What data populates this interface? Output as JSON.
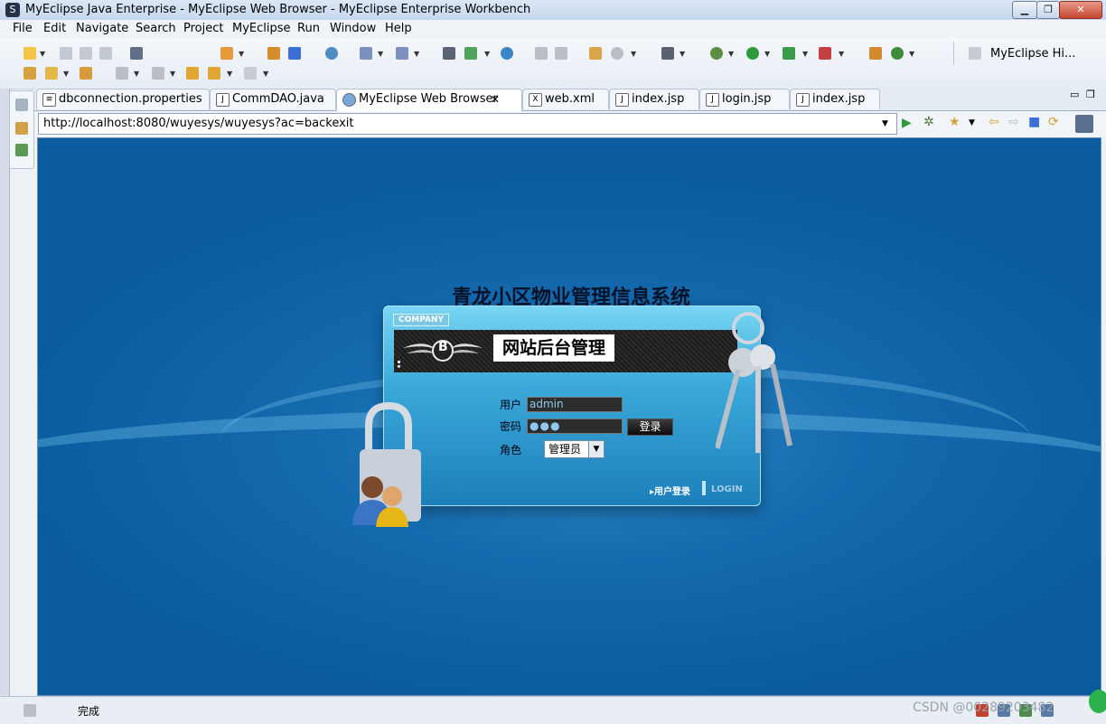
{
  "window": {
    "title": "MyEclipse Java Enterprise - MyEclipse Web Browser - MyEclipse Enterprise Workbench"
  },
  "menu": [
    "File",
    "Edit",
    "Navigate",
    "Search",
    "Project",
    "MyEclipse",
    "Run",
    "Window",
    "Help"
  ],
  "perspective": {
    "label": "MyEclipse Hi..."
  },
  "tabs": [
    {
      "label": "dbconnection.properties",
      "icon": "properties-file-icon"
    },
    {
      "label": "CommDAO.java",
      "icon": "java-file-icon"
    },
    {
      "label": "MyEclipse Web Browser",
      "icon": "web-browser-icon",
      "close": "✕"
    },
    {
      "label": "web.xml",
      "icon": "xml-file-icon"
    },
    {
      "label": "index.jsp",
      "icon": "jsp-file-icon"
    },
    {
      "label": "login.jsp",
      "icon": "jsp-file-icon"
    },
    {
      "label": "index.jsp",
      "icon": "jsp-file-icon"
    }
  ],
  "browser": {
    "url": "http://localhost:8080/wuyesys/wuyesys?ac=backexit"
  },
  "page": {
    "system_title": "青龙小区物业管理信息系统",
    "company_badge": "COMPANY",
    "banner_title": "网站后台管理",
    "logo_letter": "B",
    "username_label": "用户",
    "username_value": "admin",
    "password_label": "密码",
    "password_value": "●●●",
    "login_button": "登录",
    "role_label": "角色",
    "role_selected": "管理员",
    "footer_link": "▸用户登录",
    "footer_login": "LOGIN"
  },
  "status": {
    "text": "完成"
  },
  "watermark": "CSDN @00289203482",
  "colors": {
    "content_bg": "#0a5c9e",
    "panel_top": "#79d5f3",
    "banner": "#1b1b1b"
  }
}
